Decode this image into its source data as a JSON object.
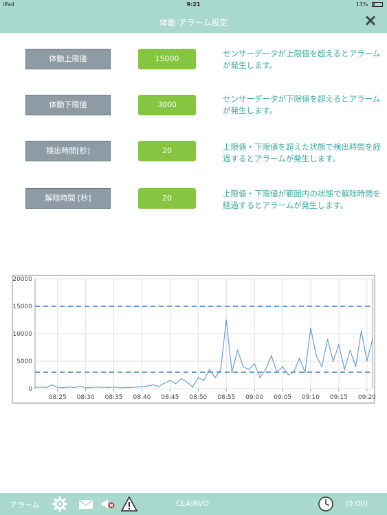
{
  "status_bar": {
    "device": "iPad",
    "time": "9:21",
    "battery": "13%"
  },
  "header": {
    "title": "体動 アラーム設定",
    "close_icon": "close-icon"
  },
  "settings": [
    {
      "label": "体動上限値",
      "value": "15000",
      "description": "センサーデータが上限値を超えるとアラームが発生します。"
    },
    {
      "label": "体動下限値",
      "value": "3000",
      "description": "センサーデータが下限値を超えるとアラームが発生します。"
    },
    {
      "label": "検出時間[秒]",
      "value": "20",
      "description": "上限値・下限値を超えた状態で検出時間を経過するとアラームが発生します。"
    },
    {
      "label": "解除時間 [秒]",
      "value": "20",
      "description": "上限値・下限値が範囲内の状態で解除時間を経過するとアラームが発生します。"
    }
  ],
  "colors": {
    "accent": "#a9d8cc",
    "button_gray": "#8e9ba4",
    "value_green": "#86c540",
    "text_teal": "#3aa8a0",
    "line_blue": "#6a9fd4"
  },
  "chart_data": {
    "type": "line",
    "x_ticks": [
      "08:25",
      "08:30",
      "08:35",
      "08:40",
      "08:45",
      "08:50",
      "08:55",
      "09:00",
      "09:05",
      "09:10",
      "09:15",
      "09:20"
    ],
    "y_ticks": [
      "0",
      "5000",
      "10000",
      "15000",
      "20000"
    ],
    "ylim": [
      0,
      20000
    ],
    "thresholds": [
      15000,
      3000
    ],
    "grid": true,
    "series": [
      {
        "x": [
          "08:21",
          "08:22",
          "08:23",
          "08:24",
          "08:25",
          "08:26",
          "08:27",
          "08:28",
          "08:29",
          "08:30",
          "08:31",
          "08:32",
          "08:33",
          "08:34",
          "08:35",
          "08:36",
          "08:37",
          "08:38",
          "08:39",
          "08:40",
          "08:41",
          "08:42",
          "08:43",
          "08:44",
          "08:45",
          "08:46",
          "08:47",
          "08:48",
          "08:49",
          "08:50",
          "08:51",
          "08:52",
          "08:53",
          "08:54",
          "08:55",
          "08:56",
          "08:57",
          "08:58",
          "08:59",
          "09:00",
          "09:01",
          "09:02",
          "09:03",
          "09:04",
          "09:05",
          "09:06",
          "09:07",
          "09:08",
          "09:09",
          "09:10",
          "09:11",
          "09:12",
          "09:13",
          "09:14",
          "09:15",
          "09:16",
          "09:17",
          "09:18",
          "09:19",
          "09:20",
          "09:21"
        ],
        "values": [
          200,
          300,
          200,
          700,
          250,
          150,
          300,
          200,
          400,
          150,
          200,
          300,
          250,
          200,
          300,
          150,
          200,
          200,
          300,
          350,
          500,
          700,
          400,
          1000,
          1500,
          900,
          1800,
          1200,
          300,
          2000,
          1500,
          3500,
          2000,
          3500,
          12500,
          3000,
          7000,
          4000,
          3500,
          4500,
          2000,
          3500,
          6000,
          3000,
          4000,
          2500,
          3000,
          5500,
          3000,
          11000,
          6000,
          4000,
          9000,
          5000,
          8000,
          3500,
          7000,
          4000,
          10500,
          5000,
          9000
        ]
      }
    ]
  },
  "toolbar": {
    "alarm_label": "アラーム",
    "app_name": "CLAIRVO",
    "timer_text": "(0:00)",
    "icons": [
      "gear-icon",
      "mail-icon",
      "speaker-muted-icon",
      "warning-icon",
      "clock-icon"
    ]
  }
}
